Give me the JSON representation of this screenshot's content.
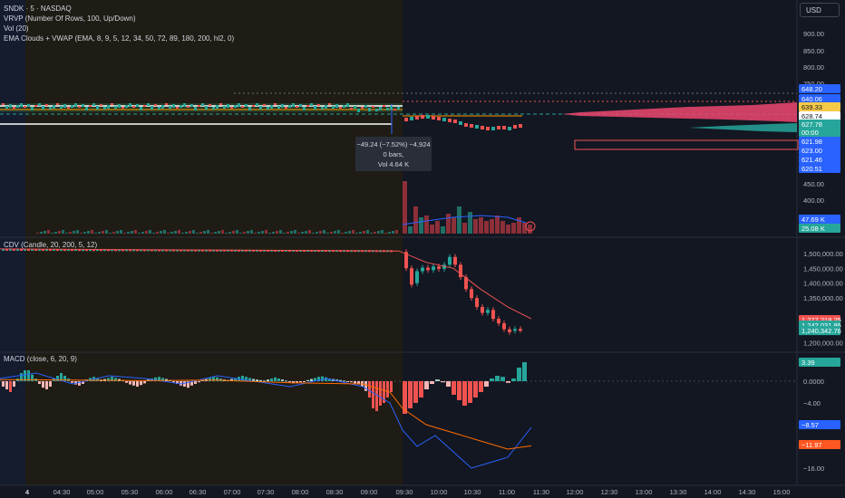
{
  "colors": {
    "background": "#131722",
    "premarket_shade": "#1f1c15",
    "overnight_shade": "#141c2e",
    "up": "#26a69a",
    "down": "#ef5350",
    "down_light": "#f5b7b5",
    "up_light": "#b2dfdb",
    "macd_line": "#2962ff",
    "signal_line": "#ff6d00",
    "grid": "#1e222d",
    "axis_text": "#b2b5be"
  },
  "header": {
    "symbol": "SNDK · 5 · NASDAQ",
    "indicator_vrvp": "VRVP (Number Of Rows, 100, Up/Down)",
    "indicator_vol": "Vol (20)",
    "indicator_ema": "EMA Clouds + VWAP (EMA, 8, 9, 5, 12, 34, 50, 72, 89, 180, 200, hl2, 0)"
  },
  "currency_button": "USD",
  "tooltip": {
    "line1": "−49.24 (−7.52%) −4,924",
    "line2": "0 bars,",
    "line3": "Vol 4.64 K"
  },
  "panes": {
    "cdv_title": "CDV (Candle, 20, 200, 5, 12)",
    "macd_title": "MACD (close, 6, 20, 9)"
  },
  "chart_data": [
    {
      "type": "line",
      "name": "price",
      "ylim": [
        380,
        930
      ],
      "y_ticks": [
        "900.00",
        "850.00",
        "800.00",
        "750.00",
        "450.00",
        "400.00"
      ],
      "price_labels": [
        {
          "text": "648.20",
          "color": "#2962ff",
          "value": 648.2
        },
        {
          "text": "640.06",
          "color": "#2962ff",
          "value": 640.06
        },
        {
          "text": "639.33",
          "color": "#f7c948",
          "value": 639.33
        },
        {
          "text": "628.74",
          "color": "#ffffff",
          "value": 628.74
        },
        {
          "text": "627.78",
          "color": "#26a69a",
          "value": 627.78
        },
        {
          "text": "00:00",
          "color": "#26a69a",
          "value": 619.5
        },
        {
          "text": "621.98",
          "color": "#2962ff",
          "value": 611.5
        },
        {
          "text": "623.00",
          "color": "#2962ff",
          "value": 603.5
        },
        {
          "text": "621.46",
          "color": "#2962ff",
          "value": 595.5
        },
        {
          "text": "620.51",
          "color": "#2962ff",
          "value": 587.5
        }
      ],
      "volume_labels": [
        {
          "text": "47.69 K",
          "color": "#2962ff"
        },
        {
          "text": "25.08 K",
          "color": "#26a69a"
        }
      ]
    },
    {
      "type": "line",
      "name": "CDV",
      "ylim": [
        1180000,
        1530000
      ],
      "y_ticks": [
        "1,500,000.00",
        "1,450,000.00",
        "1,400,000.00",
        "1,350,000.00",
        "1,200,000.00"
      ],
      "y_tick_values": [
        1500000,
        1450000,
        1400000,
        1350000,
        1200000
      ],
      "labels": [
        {
          "text": "1,277,219.25",
          "color": "#ef5350",
          "value": 1277219.25
        },
        {
          "text": "1,242,031.86",
          "color": "#26a69a",
          "value": 1259000
        },
        {
          "text": "1,240,342.76",
          "color": "#26a69a",
          "value": 1240342.76
        }
      ]
    },
    {
      "type": "bar",
      "name": "MACD",
      "ylim": [
        -18,
        6
      ],
      "y_ticks": [
        "0.0000",
        "−4.00",
        "−16.00"
      ],
      "y_tick_values": [
        0,
        -4,
        -16
      ],
      "labels": [
        {
          "text": "3.39",
          "color": "#26a69a",
          "value": 3.39
        },
        {
          "text": "−8.57",
          "color": "#2962ff",
          "value": -8.57
        },
        {
          "text": "−11.97",
          "color": "#ff5722",
          "value": -11.97
        }
      ]
    }
  ],
  "x_axis": {
    "labels": [
      "4",
      "04:30",
      "05:00",
      "05:30",
      "06:00",
      "06:30",
      "07:00",
      "07:30",
      "08:00",
      "08:30",
      "09:00",
      "09:30",
      "10:00",
      "10:30",
      "11:00",
      "11:30",
      "12:00",
      "12:30",
      "13:00",
      "13:30",
      "14:00",
      "14:30",
      "15:00"
    ]
  }
}
